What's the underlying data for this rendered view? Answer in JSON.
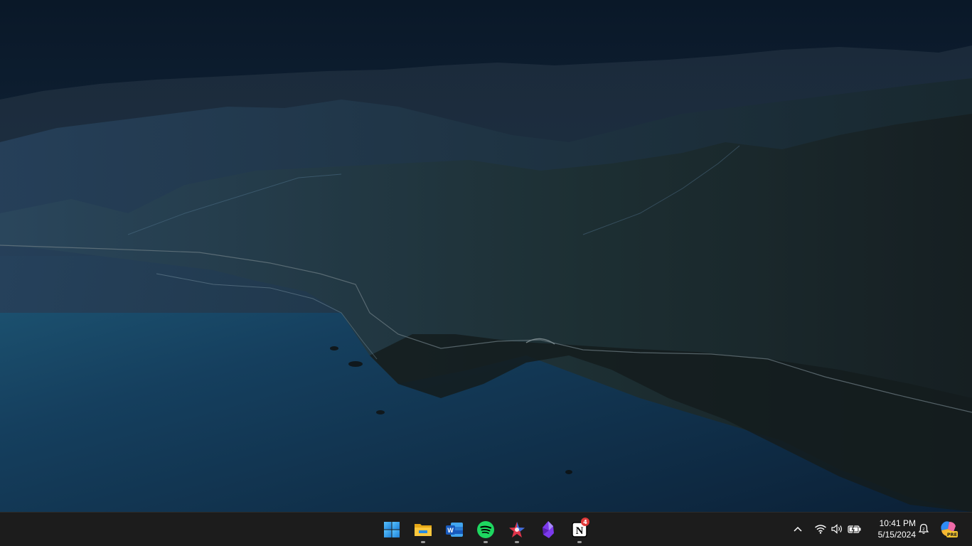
{
  "desktop": {
    "wallpaper": "coastal-mountains-night"
  },
  "taskbar": {
    "apps": [
      {
        "name": "start",
        "icon": "windows-logo-icon",
        "running": false
      },
      {
        "name": "file-explorer",
        "icon": "folder-icon",
        "running": true
      },
      {
        "name": "word",
        "icon": "word-icon",
        "running": false
      },
      {
        "name": "spotify",
        "icon": "spotify-icon",
        "running": true
      },
      {
        "name": "copilot-star",
        "icon": "star-app-icon",
        "running": true
      },
      {
        "name": "obsidian",
        "icon": "obsidian-icon",
        "running": false
      },
      {
        "name": "notion",
        "icon": "notion-icon",
        "running": true,
        "badge": "4"
      }
    ],
    "tray": {
      "icons": [
        "chevron-up-icon",
        "wifi-icon",
        "volume-icon",
        "battery-icon"
      ],
      "time": "10:41 PM",
      "date": "5/15/2024",
      "copilot_badge": "PRE"
    },
    "colors": {
      "background": "#1c1c1c",
      "windows_blue": "#2a9df4",
      "spotify_green": "#1ed760",
      "word_blue": "#185abd",
      "notification_red": "#e03a3a"
    }
  }
}
